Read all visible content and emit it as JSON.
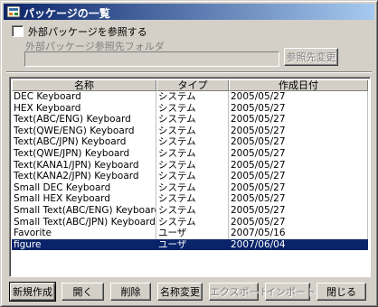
{
  "window": {
    "title": "パッケージの一覧",
    "title_gradient_start": "#0a246a",
    "title_gradient_end": "#a6caf0"
  },
  "options": {
    "use_external_label": "外部パッケージを参照する",
    "use_external_checked": false,
    "folder_label": "外部パッケージ参照先フォルダ",
    "folder_value": "",
    "change_folder_button": "参照先変更"
  },
  "list": {
    "columns": [
      "名称",
      "タイプ",
      "作成日付"
    ],
    "rows": [
      [
        "DEC Keyboard",
        "システム",
        "2005/05/27"
      ],
      [
        "HEX Keyboard",
        "システム",
        "2005/05/27"
      ],
      [
        "Text(ABC/ENG) Keyboard",
        "システム",
        "2005/05/27"
      ],
      [
        "Text(QWE/ENG) Keyboard",
        "システム",
        "2005/05/27"
      ],
      [
        "Text(ABC/JPN) Keyboard",
        "システム",
        "2005/05/27"
      ],
      [
        "Text(QWE/JPN) Keyboard",
        "システム",
        "2005/05/27"
      ],
      [
        "Text(KANA1/JPN) Keyboard",
        "システム",
        "2005/05/27"
      ],
      [
        "Text(KANA2/JPN) Keyboard",
        "システム",
        "2005/05/27"
      ],
      [
        "Small DEC Keyboard",
        "システム",
        "2005/05/27"
      ],
      [
        "Small HEX Keyboard",
        "システム",
        "2005/05/27"
      ],
      [
        "Small Text(ABC/ENG) Keyboard",
        "システム",
        "2005/05/27"
      ],
      [
        "Small Text(ABC/JPN) Keyboard",
        "システム",
        "2005/05/27"
      ],
      [
        "Favorite",
        "ユーザ",
        "2007/05/16"
      ],
      [
        "figure",
        "ユーザ",
        "2007/06/04"
      ]
    ],
    "selected_index": 13,
    "selection_color": "#0a246a"
  },
  "buttons": {
    "new": "新規作成",
    "open": "開く",
    "delete": "削除",
    "rename": "名称変更",
    "export": "エクスポート",
    "import": "インポート",
    "close": "閉じる"
  }
}
